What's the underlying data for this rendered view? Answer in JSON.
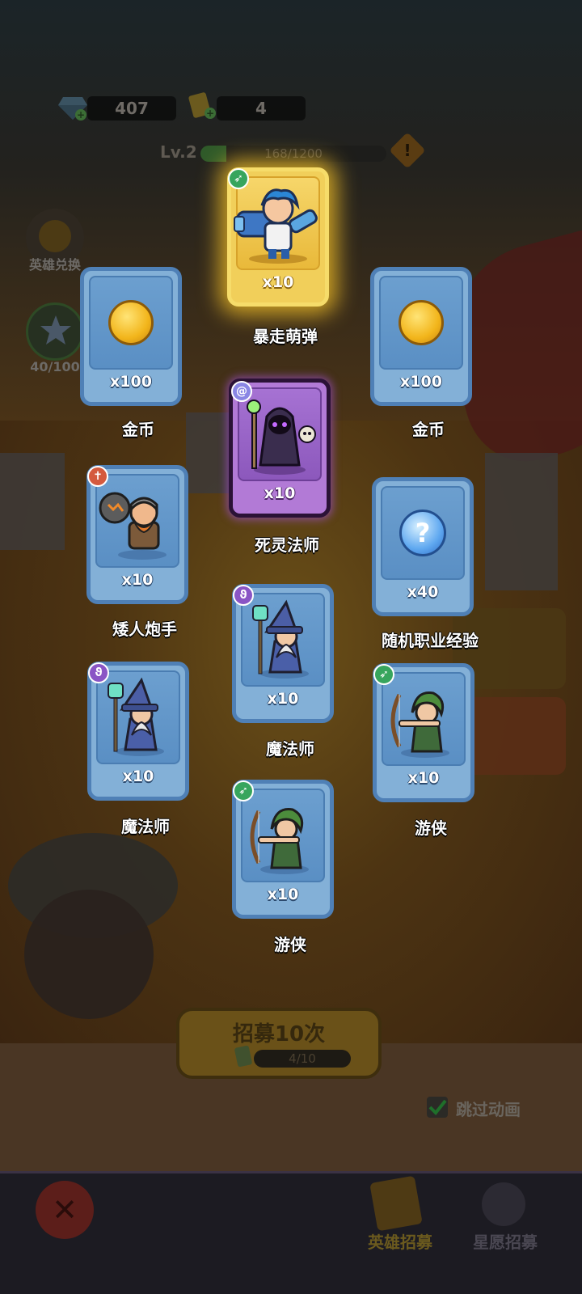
{
  "resources": {
    "gems": "407",
    "tickets": "4"
  },
  "level": {
    "label": "Lv.2",
    "xp_text": "168/1200",
    "xp_fraction": 0.14,
    "warning_symbol": "!"
  },
  "side": {
    "hero_exchange_label": "英雄兑换",
    "star_progress": "40/100"
  },
  "cards": [
    {
      "id": "c1",
      "name": "暴走萌弹",
      "count": "x10",
      "rarity": "gold",
      "badge": "bow",
      "art": "hero-gunner"
    },
    {
      "id": "c2",
      "name": "金币",
      "count": "x100",
      "rarity": "blue",
      "art": "coin"
    },
    {
      "id": "c3",
      "name": "金币",
      "count": "x100",
      "rarity": "blue",
      "art": "coin"
    },
    {
      "id": "c4",
      "name": "死灵法师",
      "count": "x10",
      "rarity": "purple",
      "badge": "spiral",
      "art": "necromancer"
    },
    {
      "id": "c5",
      "name": "矮人炮手",
      "count": "x10",
      "rarity": "blue",
      "badge": "sword",
      "art": "dwarf"
    },
    {
      "id": "c6",
      "name": "随机职业经验",
      "count": "x40",
      "rarity": "blue",
      "art": "question"
    },
    {
      "id": "c7",
      "name": "魔法师",
      "count": "x10",
      "rarity": "blue",
      "badge": "staff",
      "art": "wizard"
    },
    {
      "id": "c8",
      "name": "魔法师",
      "count": "x10",
      "rarity": "blue",
      "badge": "staff",
      "art": "wizard"
    },
    {
      "id": "c9",
      "name": "游侠",
      "count": "x10",
      "rarity": "blue",
      "badge": "bow",
      "art": "ranger"
    },
    {
      "id": "c10",
      "name": "游侠",
      "count": "x10",
      "rarity": "blue",
      "badge": "bow",
      "art": "ranger"
    }
  ],
  "recruit": {
    "label": "招募10次",
    "progress": "4/10",
    "fraction": 0.4
  },
  "skip": {
    "label": "跳过动画",
    "checked": true
  },
  "bottom_tabs": [
    {
      "label": "英雄招募",
      "active": true
    },
    {
      "label": "星愿招募",
      "active": false
    }
  ],
  "colors": {
    "gold": "#f1cf5a",
    "purple": "#b27ad6",
    "blue": "#83b0d7",
    "active_tab": "#6b5a1e"
  }
}
